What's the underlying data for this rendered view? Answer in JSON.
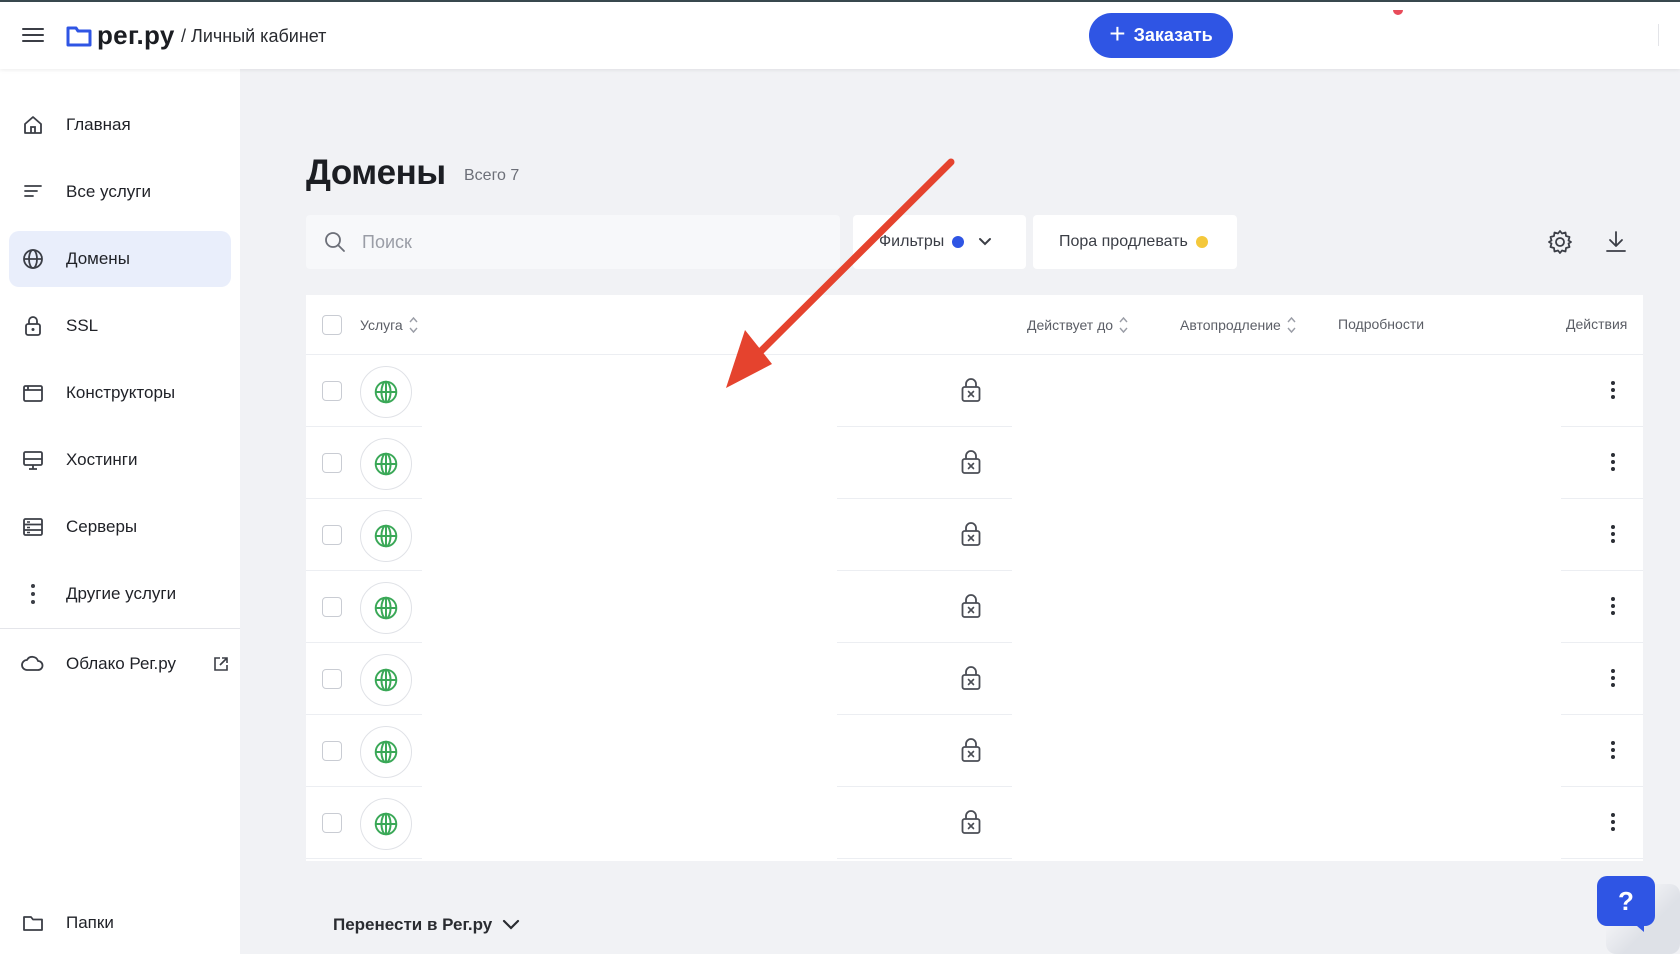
{
  "header": {
    "logo_text": "рег.ру",
    "breadcrumb": "/ Личный кабинет",
    "order_button": "Заказать"
  },
  "sidebar": {
    "items": [
      {
        "label": "Главная",
        "icon": "home-icon"
      },
      {
        "label": "Все услуги",
        "icon": "list-icon"
      },
      {
        "label": "Домены",
        "icon": "globe-icon",
        "active": true
      },
      {
        "label": "SSL",
        "icon": "lock-icon"
      },
      {
        "label": "Конструкторы",
        "icon": "browser-window-icon"
      },
      {
        "label": "Хостинги",
        "icon": "monitor-icon"
      },
      {
        "label": "Серверы",
        "icon": "server-icon"
      },
      {
        "label": "Другие услуги",
        "icon": "more-vertical-icon"
      }
    ],
    "cloud": {
      "label": "Облако Рег.ру",
      "icon": "cloud-icon"
    },
    "folders": {
      "label": "Папки",
      "icon": "folder-icon"
    }
  },
  "page": {
    "title": "Домены",
    "total": "Всего 7"
  },
  "toolbar": {
    "search_placeholder": "Поиск",
    "filters_label": "Фильтры",
    "renew_label": "Пора продлевать"
  },
  "table": {
    "columns": {
      "service": "Услуга",
      "valid_until": "Действует до",
      "autorenew": "Автопродление",
      "details": "Подробности",
      "actions": "Действия"
    },
    "rows": [
      {
        "name": "",
        "locked": true
      },
      {
        "name": "",
        "locked": true
      },
      {
        "name": "",
        "locked": true
      },
      {
        "name": "",
        "locked": true
      },
      {
        "name": "",
        "locked": true
      },
      {
        "name": "",
        "locked": true
      },
      {
        "name": "",
        "locked": true
      }
    ]
  },
  "footer": {
    "transfer_label": "Перенести в Рег.ру"
  },
  "help": {
    "label": "?"
  },
  "colors": {
    "accent": "#2f55e4",
    "globe_green": "#3aa857",
    "annotation_red": "#e5432e",
    "renew_yellow": "#f4c83b"
  }
}
